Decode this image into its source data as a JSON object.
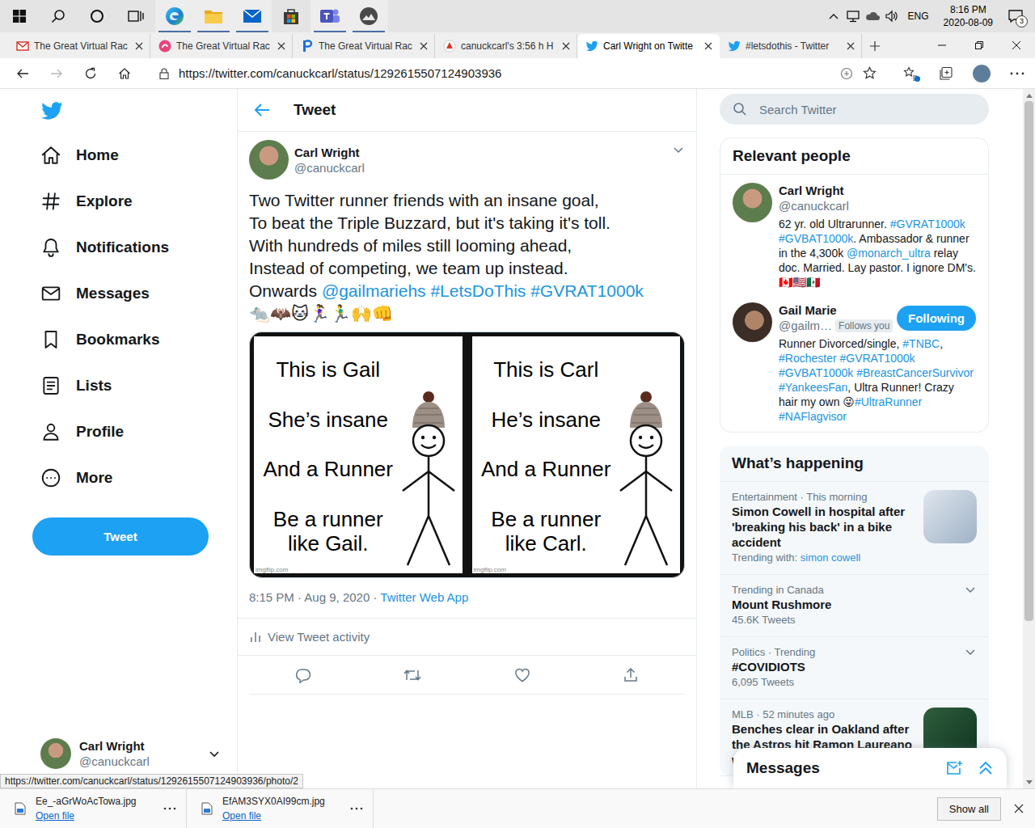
{
  "taskbar": {
    "apps": [
      {
        "kind": "start",
        "running": false
      },
      {
        "kind": "search",
        "running": false
      },
      {
        "kind": "cortana",
        "running": false
      },
      {
        "kind": "task-view",
        "running": false
      },
      {
        "kind": "edge",
        "running": true
      },
      {
        "kind": "explorer",
        "running": true
      },
      {
        "kind": "mail",
        "running": true
      },
      {
        "kind": "store",
        "running": false
      },
      {
        "kind": "teams",
        "running": true
      },
      {
        "kind": "photo-app",
        "running": true
      }
    ],
    "tray": {
      "language": "ENG",
      "time": "8:16 PM",
      "date": "2020-08-09",
      "notifications": "3"
    }
  },
  "browser": {
    "tabs": [
      {
        "label": "The Great Virtual Rac",
        "favicon": "gmail",
        "selected": false
      },
      {
        "label": "The Great Virtual Rac",
        "favicon": "pink",
        "selected": false
      },
      {
        "label": "The Great Virtual Rac",
        "favicon": "blue-p",
        "selected": false
      },
      {
        "label": "canuckcarl's 3:56 h H",
        "favicon": "strava",
        "selected": false
      },
      {
        "label": "Carl Wright on Twitte",
        "favicon": "twitter",
        "selected": true
      },
      {
        "label": "#letsdothis - Twitter",
        "favicon": "twitter",
        "selected": false
      }
    ],
    "url": "https://twitter.com/canuckcarl/status/1292615507124903936",
    "forward_disabled": true,
    "status_url": "https://twitter.com/canuckcarl/status/1292615507124903936/photo/2"
  },
  "twitter": {
    "nav": [
      {
        "label": "Home",
        "icon": "home",
        "selected": false
      },
      {
        "label": "Explore",
        "icon": "explore",
        "selected": false
      },
      {
        "label": "Notifications",
        "icon": "bell",
        "selected": false
      },
      {
        "label": "Messages",
        "icon": "envelope",
        "selected": false
      },
      {
        "label": "Bookmarks",
        "icon": "bookmark",
        "selected": false
      },
      {
        "label": "Lists",
        "icon": "lists",
        "selected": false
      },
      {
        "label": "Profile",
        "icon": "profile",
        "selected": false
      },
      {
        "label": "More",
        "icon": "more",
        "selected": false
      }
    ],
    "tweet_button": "Tweet",
    "account": {
      "name": "Carl Wright",
      "handle": "@canuckcarl"
    },
    "header": "Tweet",
    "tweet": {
      "name": "Carl Wright",
      "handle": "@canuckcarl",
      "lines": [
        [
          {
            "text": "Two Twitter runner friends with an insane goal,",
            "link": false
          }
        ],
        [
          {
            "text": "To beat the Triple Buzzard, but it's taking it's toll.",
            "link": false
          }
        ],
        [
          {
            "text": "With hundreds of miles still looming ahead,",
            "link": false
          }
        ],
        [
          {
            "text": "Instead of competing, we team up instead.",
            "link": false
          }
        ],
        [
          {
            "text": "Onwards ",
            "link": false
          },
          {
            "text": "@gailmariehs",
            "link": true
          },
          {
            "text": " ",
            "link": false
          },
          {
            "text": "#LetsDoThis",
            "link": true
          },
          {
            "text": " ",
            "link": false
          },
          {
            "text": "#GVRAT1000k",
            "link": true
          }
        ],
        [
          {
            "text": "🐀🦇🐱🏃‍♀️🏃‍♂️🙌👊",
            "link": false
          }
        ]
      ],
      "media": [
        {
          "lines": [
            "This is Gail",
            "She’s insane",
            "And a Runner",
            "Be a runner like Gail."
          ],
          "watermark": "imgflip.com"
        },
        {
          "lines": [
            "This is Carl",
            "He’s insane",
            "And a Runner",
            "Be a runner like Carl."
          ],
          "watermark": "imgflip.com"
        }
      ],
      "timestamp": "8:15 PM · Aug 9, 2020 · ",
      "source": "Twitter Web App",
      "activity": "View Tweet activity"
    },
    "search_placeholder": "Search Twitter",
    "relevant": {
      "title": "Relevant people",
      "people": [
        {
          "name": "Carl Wright",
          "handle": "@canuckcarl",
          "follows_you": "",
          "button": "",
          "bio": [
            {
              "text": "62 yr. old Ultrarunner. ",
              "link": false
            },
            {
              "text": "#GVRAT1000k",
              "link": true
            },
            {
              "text": " ",
              "link": false
            },
            {
              "text": "#GVBAT1000k",
              "link": true
            },
            {
              "text": ". Ambassador & runner in the 4,300k ",
              "link": false
            },
            {
              "text": "@monarch_ultra",
              "link": true
            },
            {
              "text": " relay doc. Married. Lay pastor. I ignore DM's. 🇨🇦🇺🇸🇲🇽",
              "link": false
            }
          ]
        },
        {
          "name": "Gail Marie",
          "handle": "@gailm…",
          "follows_you": "Follows you",
          "button": "Following",
          "bio": [
            {
              "text": "Runner Divorced/single, ",
              "link": false
            },
            {
              "text": "#TNBC",
              "link": true
            },
            {
              "text": ", ",
              "link": false
            },
            {
              "text": "#Rochester",
              "link": true
            },
            {
              "text": " ",
              "link": false
            },
            {
              "text": "#GVRAT1000k",
              "link": true
            },
            {
              "text": " ",
              "link": false
            },
            {
              "text": "#GVBAT1000k",
              "link": true
            },
            {
              "text": " ",
              "link": false
            },
            {
              "text": "#BreastCancerSurvivor",
              "link": true
            },
            {
              "text": " ",
              "link": false
            },
            {
              "text": "#YankeesFan",
              "link": true
            },
            {
              "text": ", Ultra Runner! Crazy hair my own 😜",
              "link": false
            },
            {
              "text": "#UltraRunner",
              "link": true
            },
            {
              "text": " ",
              "link": false
            },
            {
              "text": "#NAFlagvisor",
              "link": true
            }
          ]
        }
      ]
    },
    "trends": {
      "title": "What’s happening",
      "items": [
        {
          "kind": "news",
          "context": "Entertainment · This morning",
          "title": "Simon Cowell in hospital after 'breaking his back' in a bike accident",
          "meta": "Trending with: ",
          "meta_link": "simon cowell"
        },
        {
          "kind": "trend",
          "context": "Trending in Canada",
          "title": "Mount Rushmore",
          "meta": "45.6K Tweets",
          "meta_link": ""
        },
        {
          "kind": "trend",
          "context": "Politics · Trending",
          "title": "#COVIDIOTS",
          "meta": "6,095 Tweets",
          "meta_link": ""
        },
        {
          "kind": "news",
          "context": "MLB · 52 minutes ago",
          "title": "Benches clear in Oakland after the Astros hit Ramon Laureano wi",
          "meta": "",
          "meta_link": ""
        }
      ]
    },
    "messages": "Messages"
  },
  "scrollbar": {
    "level": 0,
    "thumb_share": 0.77
  },
  "downloads": {
    "files": [
      {
        "name": "Ee_-aGrWoAcTowa.jpg",
        "action": "Open file"
      },
      {
        "name": "EfAM3SYX0AI99cm.jpg",
        "action": "Open file"
      }
    ],
    "show_all": "Show all"
  }
}
